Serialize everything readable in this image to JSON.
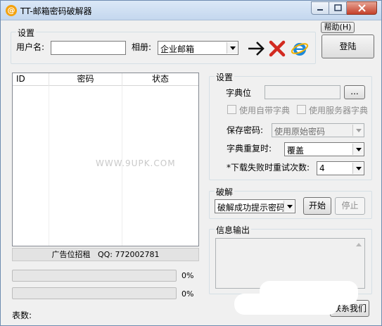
{
  "window": {
    "title": "TT-邮箱密码破解器",
    "app_icon_glyph": "@"
  },
  "top_bar": {
    "help_label": "帮助(H)",
    "login_label": "登陆"
  },
  "settings_top": {
    "group_label": "设置",
    "username_label": "用户名:",
    "username_value": "",
    "mailbox_label": "相册:",
    "mailbox_value": "企业邮箱",
    "icons": [
      "arrow-right-icon",
      "red-x-icon",
      "ie-browser-icon"
    ]
  },
  "list": {
    "columns": [
      "ID",
      "密码",
      "状态"
    ],
    "rows": [],
    "watermark": "WWW.9UPK.COM"
  },
  "ad_bar": {
    "label": "广告位招租",
    "qq": "QQ: 772002781"
  },
  "progress": [
    {
      "value": 0,
      "label": "0%"
    },
    {
      "value": 0,
      "label": "0%"
    }
  ],
  "status_bar": {
    "count_label": "表数:"
  },
  "settings_right": {
    "group_label": "设置",
    "dict_label": "字典位",
    "dict_value": "",
    "browse_label": "...",
    "use_builtin_dict": "使用自带字典",
    "use_server_dict": "使用服务器字典",
    "save_password_label": "保存密码:",
    "save_password_value": "使用原始密码",
    "dict_repeat_label": "字典重复时:",
    "dict_repeat_value": "覆盖",
    "retry_label": "*下载失败时重试次数:",
    "retry_value": "4"
  },
  "crack": {
    "group_label": "破解",
    "mode_value": "破解成功提示密码",
    "start_label": "开始",
    "stop_label": "停止"
  },
  "info": {
    "group_label": "信息输出",
    "content": ""
  },
  "contact": {
    "label": "联系我们"
  }
}
